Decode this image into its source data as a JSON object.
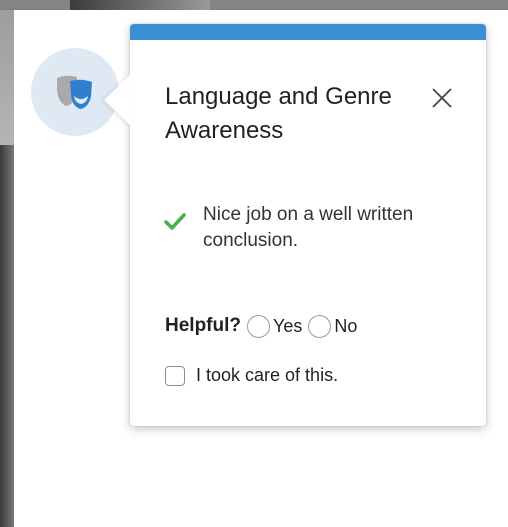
{
  "popover": {
    "title": "Language and Genre Awareness",
    "feedback": "Nice job on a well written conclusion.",
    "helpful_label": "Helpful?",
    "yes_label": "Yes",
    "no_label": "No",
    "took_care_label": "I took care of this.",
    "accent_color": "#3b8fd4",
    "check_color": "#4cae4c"
  },
  "icons": {
    "avatar": "theater-masks-icon",
    "close": "close-icon",
    "feedback": "checkmark-icon"
  }
}
